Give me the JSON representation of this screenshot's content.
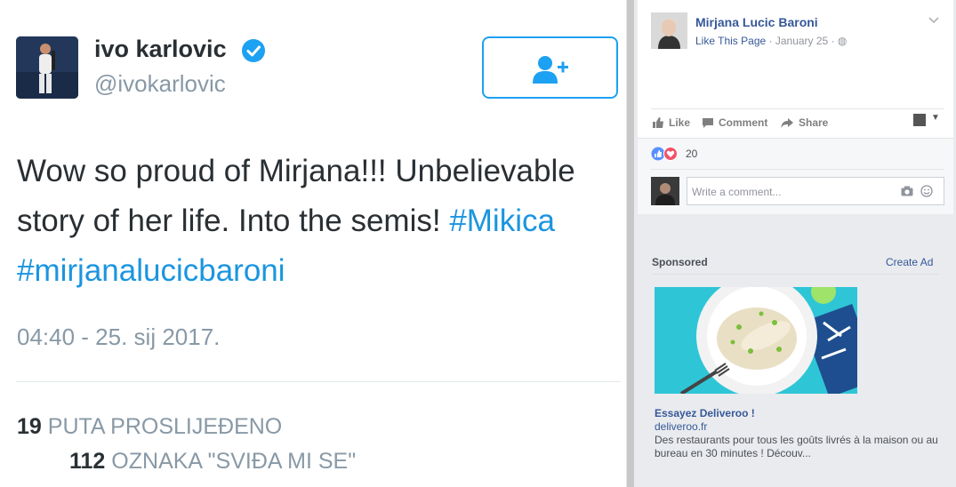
{
  "tweet": {
    "author_name": "ivo karlovic",
    "handle": "@ivokarlovic",
    "verified": true,
    "text_part1": "Wow so proud of Mirjana!!! Unbelievable story of her life. Into the semis! ",
    "hashtag1": "#Mikica",
    "hashtag2": "#mirjanalucicbaroni",
    "timestamp": "04:40 - 25. sij 2017.",
    "retweets_count": "19",
    "retweets_label": "PUTA PROSLIJEĐENO",
    "likes_count": "112",
    "likes_label": "OZNAKA \"SVIĐA MI SE\"",
    "follow_icon": "add-user-icon",
    "accent_color": "#1da1f2"
  },
  "facebook_post": {
    "page_name": "Mirjana Lucic Baroni",
    "like_page": "Like This Page",
    "date": "January 25",
    "separator": "·",
    "actions": {
      "like": "Like",
      "comment": "Comment",
      "share": "Share"
    },
    "reactions_count": "20",
    "comment_placeholder": "Write a comment..."
  },
  "sponsored": {
    "label": "Sponsored",
    "create_ad": "Create Ad",
    "ad_title": "Essayez Deliveroo !",
    "ad_domain": "deliveroo.fr",
    "ad_description": "Des restaurants pour tous les goûts livrés à la maison ou au bureau en 30 minutes ! Découv..."
  }
}
